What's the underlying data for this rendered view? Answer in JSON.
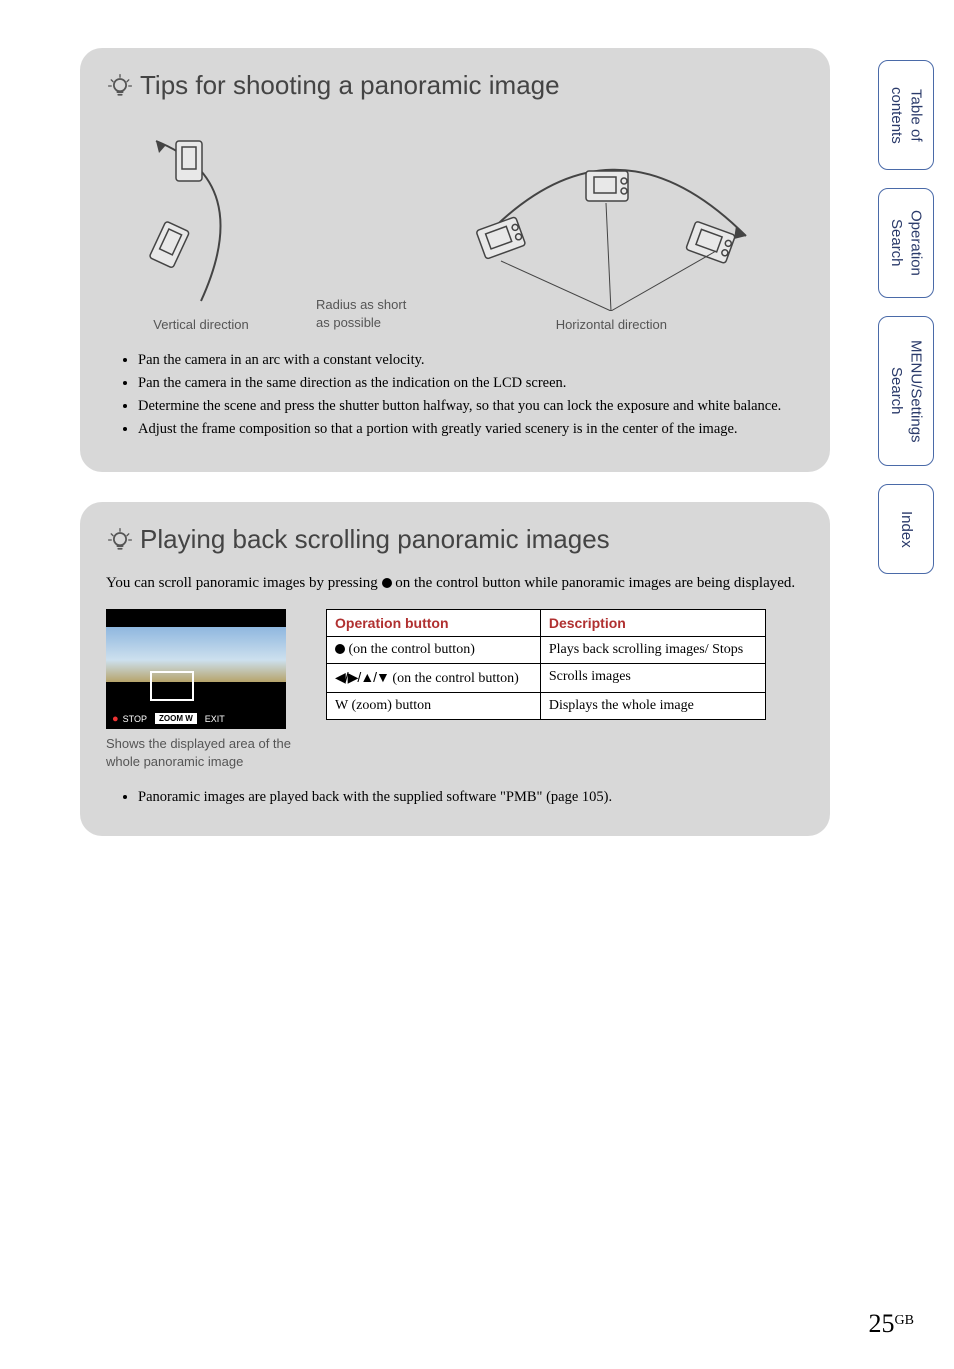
{
  "sidebar": {
    "items": [
      {
        "label": "Table of\ncontents"
      },
      {
        "label": "Operation\nSearch"
      },
      {
        "label": "MENU/Settings\nSearch"
      },
      {
        "label": "Index"
      }
    ]
  },
  "panel1": {
    "title": "Tips for shooting a panoramic image",
    "diagram": {
      "vertical_label": "Vertical direction",
      "radius_label": "Radius as short\nas possible",
      "horizontal_label": "Horizontal direction"
    },
    "bullets": [
      "Pan the camera in an arc with a constant velocity.",
      "Pan the camera in the same direction as the indication on the LCD screen.",
      "Determine the scene and press the shutter button halfway, so that you can lock the exposure and white balance.",
      "Adjust the frame composition so that a portion with greatly varied scenery is in the center of the image."
    ]
  },
  "panel2": {
    "title": "Playing back scrolling panoramic images",
    "intro_pre": "You can scroll panoramic images by pressing ",
    "intro_post": " on the control button while panoramic images are being displayed.",
    "thumb": {
      "stop_label": "STOP",
      "zoom_label": "ZOOM W",
      "exit_label": "EXIT",
      "caption": "Shows the displayed area of the whole panoramic image"
    },
    "table": {
      "head_op": "Operation button",
      "head_desc": "Description",
      "rows": [
        {
          "op_suffix": " (on the control button)",
          "desc": "Plays back scrolling images/ Stops",
          "type": "dot"
        },
        {
          "op_suffix": " (on the control button)",
          "desc": "Scrolls images",
          "type": "arrows"
        },
        {
          "op": "W (zoom) button",
          "desc": "Displays the whole image",
          "type": "plain"
        }
      ]
    },
    "note": "Panoramic images are played back with the supplied software \"PMB\" (page 105)."
  },
  "page": {
    "number": "25",
    "suffix": "GB"
  }
}
